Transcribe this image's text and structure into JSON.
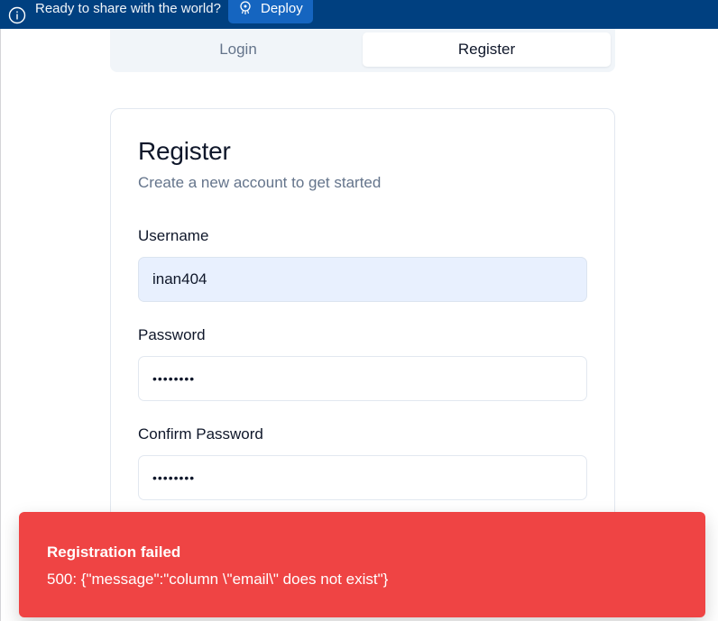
{
  "banner": {
    "text": "Ready to share with the world?",
    "deploy_label": "Deploy",
    "info_icon": "info-circle-icon",
    "deploy_icon": "deploy-icon"
  },
  "tabs": [
    {
      "label": "Login",
      "active": false
    },
    {
      "label": "Register",
      "active": true
    }
  ],
  "register": {
    "title": "Register",
    "subtitle": "Create a new account to get started",
    "fields": {
      "username": {
        "label": "Username",
        "value": "inan404"
      },
      "password": {
        "label": "Password",
        "masked": "••••••••"
      },
      "confirm_password": {
        "label": "Confirm Password",
        "masked": "••••••••"
      }
    }
  },
  "toast": {
    "title": "Registration failed",
    "description": "500: {\"message\":\"column \\\"email\\\" does not exist\"}"
  },
  "colors": {
    "banner": "#004080",
    "deploy_button": "#1565c0",
    "toast": "#ef4444",
    "autofill": "#e8f0fe",
    "muted_text": "#64748b"
  }
}
